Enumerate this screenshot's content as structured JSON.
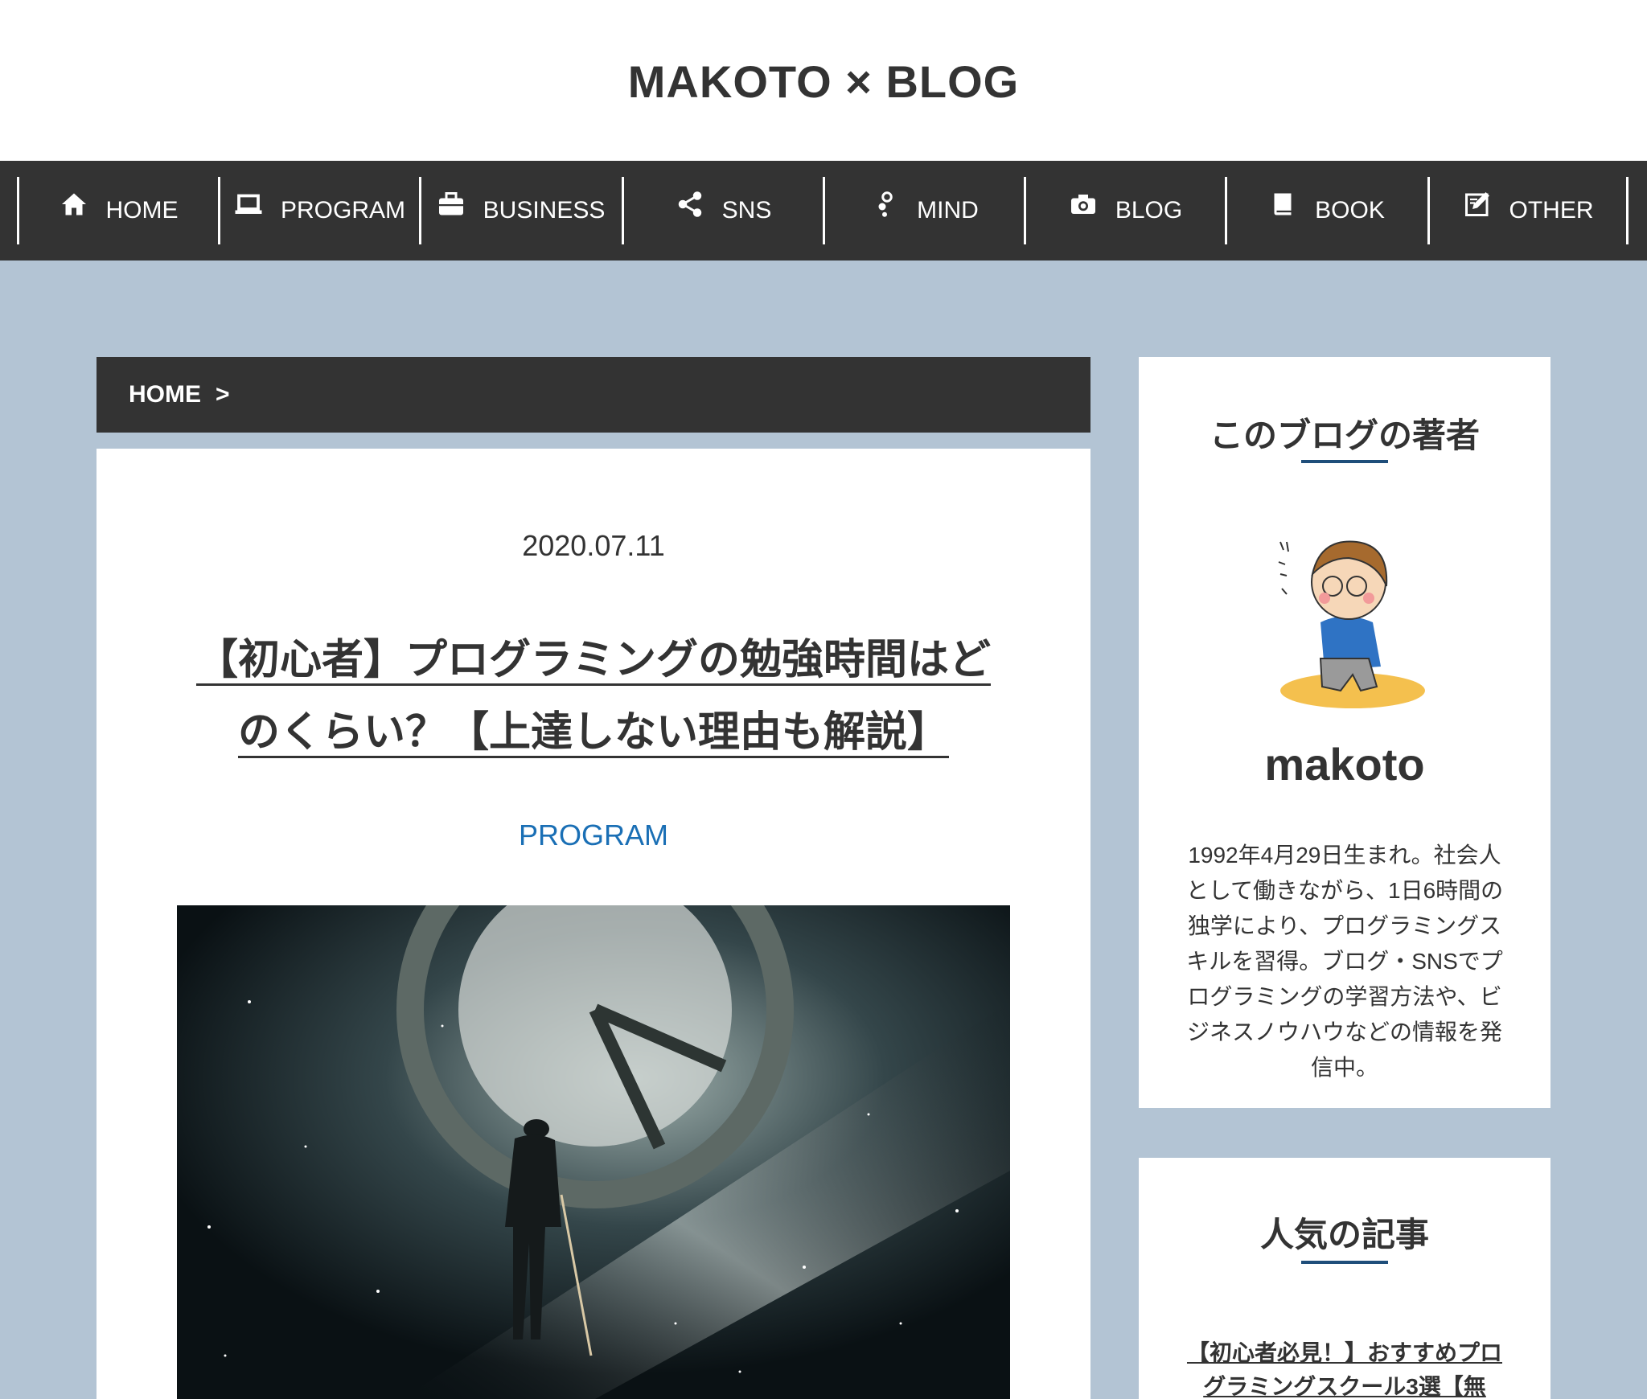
{
  "site": {
    "title": "MAKOTO × BLOG"
  },
  "nav": {
    "items": [
      {
        "label": "HOME",
        "icon": "home-icon"
      },
      {
        "label": "PROGRAM",
        "icon": "laptop-icon"
      },
      {
        "label": "BUSINESS",
        "icon": "briefcase-icon"
      },
      {
        "label": "SNS",
        "icon": "share-icon"
      },
      {
        "label": "MIND",
        "icon": "mind-icon"
      },
      {
        "label": "BLOG",
        "icon": "camera-icon"
      },
      {
        "label": "BOOK",
        "icon": "book-icon"
      },
      {
        "label": "OTHER",
        "icon": "edit-icon"
      }
    ]
  },
  "breadcrumb": {
    "home": "HOME",
    "separator": ">"
  },
  "post": {
    "date": "2020.07.11",
    "title_line1": "【初心者】プログラミングの勉強時間はど",
    "title_line2": "のくらい？【上達しない理由も解説】",
    "category": "PROGRAM"
  },
  "sidebar": {
    "profile": {
      "heading": "このブログの著者",
      "name": "makoto",
      "bio": "1992年4月29日生まれ。社会人として働きながら、1日6時間の独学により、プログラミングスキルを習得。ブログ・SNSでプログラミングの学習方法や、ビジネスノウハウなどの情報を発信中。"
    },
    "popular": {
      "heading": "人気の記事",
      "first_article": "【初心者必見！】おすすめプログラミングスクール3選【無"
    }
  },
  "colors": {
    "background": "#b3c4d4",
    "nav": "#333333",
    "accent_link": "#1a6fb5",
    "heading_underline": "#1f4e7a"
  }
}
